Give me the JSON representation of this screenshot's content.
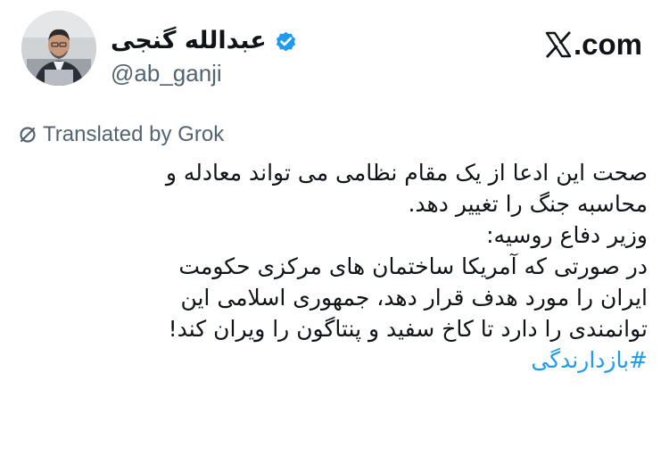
{
  "author": {
    "display_name": "عبدالله گنجی",
    "handle": "@ab_ganji",
    "verified": true,
    "avatar_icon": "portrait-avatar"
  },
  "brand": {
    "logo_icon": "x-logo-icon",
    "domain": ".com"
  },
  "translation": {
    "icon": "translate-icon",
    "label": "Translated by Grok"
  },
  "tweet": {
    "lines": [
      "صحت این ادعا از یک مقام نظامی می تواند معادله و",
      "محاسبه جنگ را تغییر دهد.",
      "وزیر دفاع روسیه:",
      "در صورتی که آمریکا ساختمان های مرکزی حکومت",
      "ایران را مورد هدف قرار دهد، جمهوری اسلامی این",
      "توانمندی را دارد تا کاخ سفید و پنتاگون را ویران کند!"
    ],
    "hashtag": "#بازدارندگی"
  },
  "colors": {
    "text": "#0f1419",
    "secondary_text": "#536471",
    "hashtag": "#1d9bf0",
    "verified_badge": "#1d9bf0"
  }
}
